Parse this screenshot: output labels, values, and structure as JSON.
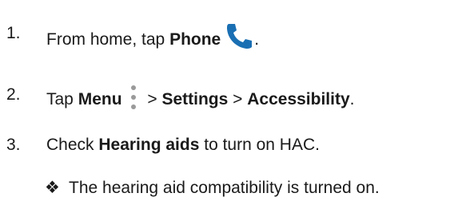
{
  "steps": [
    {
      "number": "1.",
      "prefix": "From home, tap ",
      "bold1": "Phone",
      "suffix": "."
    },
    {
      "number": "2.",
      "prefix": "Tap ",
      "bold1": "Menu",
      "sep1": " > ",
      "bold2": "Settings",
      "sep2": " > ",
      "bold3": "Accessibility",
      "suffix": "."
    },
    {
      "number": "3.",
      "prefix": "Check ",
      "bold1": "Hearing aids",
      "suffix": " to turn on HAC."
    }
  ],
  "note": {
    "symbol": "❖",
    "text": "The hearing aid compatibility is turned on."
  },
  "icons": {
    "phone": "phone-icon",
    "menu": "menu-dots-icon"
  },
  "colors": {
    "phone_icon": "#1a6fb3",
    "menu_icon": "#9a9a9a"
  }
}
